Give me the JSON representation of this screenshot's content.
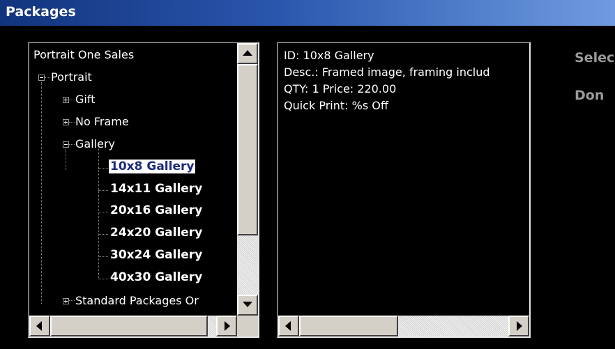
{
  "window": {
    "title": "Packages"
  },
  "tree": {
    "root": "Portrait One Sales",
    "portrait": "Portrait",
    "gift": "Gift",
    "no_frame": "No Frame",
    "gallery": "Gallery",
    "items": [
      "10x8 Gallery",
      "14x11 Gallery",
      "20x16 Gallery",
      "24x20 Gallery",
      "30x24 Gallery",
      "40x30 Gallery"
    ],
    "selected": "10x8 Gallery",
    "standard": "Standard Packages Or"
  },
  "details": {
    "id_line": "ID: 10x8 Gallery",
    "desc_line": "Desc.: Framed image, framing includ",
    "qty_line": "QTY: 1 Price: 220.00",
    "quick_line": "Quick Print: %s Off"
  },
  "side": {
    "select": "Selec",
    "done": "Don"
  },
  "colors": {
    "titlebar_start": "#12347d",
    "titlebar_end": "#6f9ce0",
    "selection_text": "#1b2a7a"
  }
}
